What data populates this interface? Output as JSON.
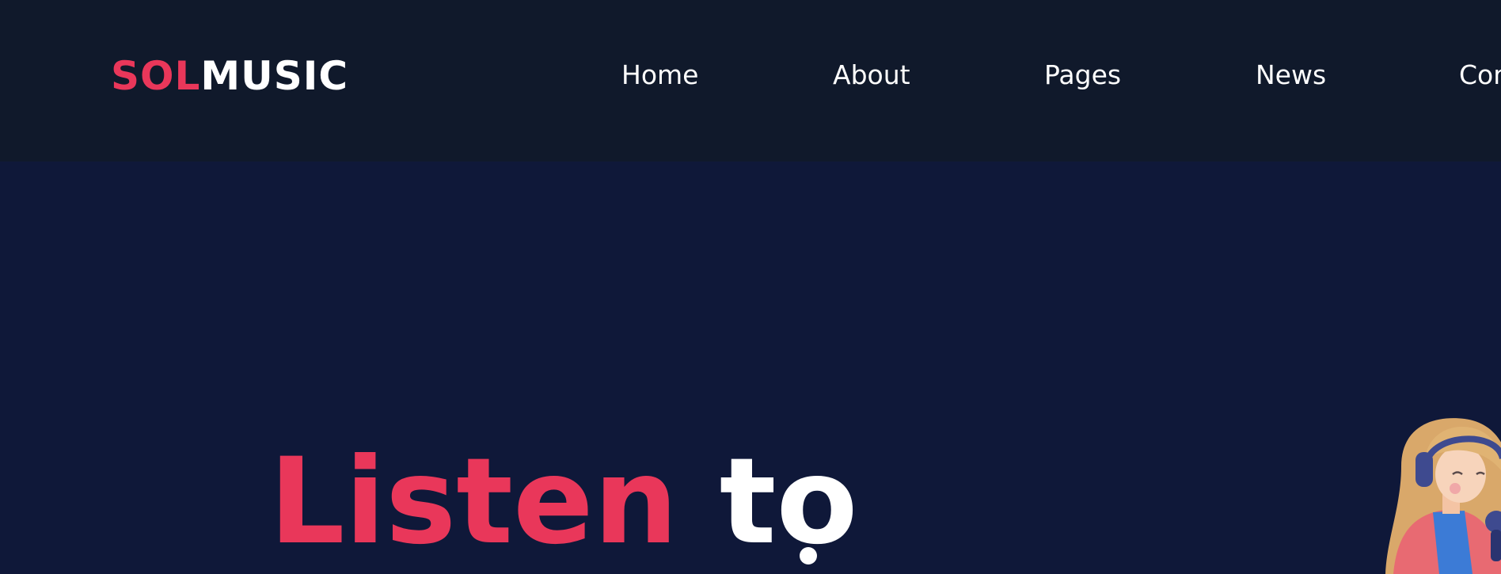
{
  "header": {
    "logo": {
      "accent": "SOL",
      "rest": "MUSIC"
    },
    "nav": [
      {
        "label": "Home"
      },
      {
        "label": "About"
      },
      {
        "label": "Pages"
      },
      {
        "label": "News"
      },
      {
        "label": "Con"
      }
    ]
  },
  "hero": {
    "headline_accent": "Listen",
    "headline_rest": "to",
    "illustration": "woman-with-headphones-and-microphone"
  },
  "colors": {
    "header_bg": "#10192b",
    "hero_bg": "#0f1839",
    "accent": "#e9375a",
    "text": "#ffffff"
  }
}
